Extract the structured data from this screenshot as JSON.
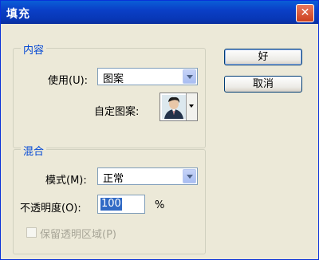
{
  "window": {
    "title": "填充",
    "close_glyph": "✕"
  },
  "content_group": {
    "legend": "内容",
    "use_label": "使用(U):",
    "use_value": "图案",
    "custom_pattern_label": "自定图案:"
  },
  "blend_group": {
    "legend": "混合",
    "mode_label": "模式(M):",
    "mode_value": "正常",
    "opacity_label": "不透明度(O):",
    "opacity_value": "100",
    "opacity_unit": "%",
    "preserve_transparency_label": "保留透明区域(P)",
    "preserve_transparency_checked": false,
    "preserve_transparency_enabled": false
  },
  "buttons": {
    "ok_label": "好",
    "cancel_label": "取消"
  },
  "icons": {
    "close": "close-icon",
    "dropdown": "chevron-down-icon",
    "pattern": "portrait-pattern-icon"
  },
  "colors": {
    "title_bar": "#0a3fc7",
    "legend_text": "#0046d5",
    "dialog_bg": "#ece9d8",
    "selection": "#316ac5"
  }
}
